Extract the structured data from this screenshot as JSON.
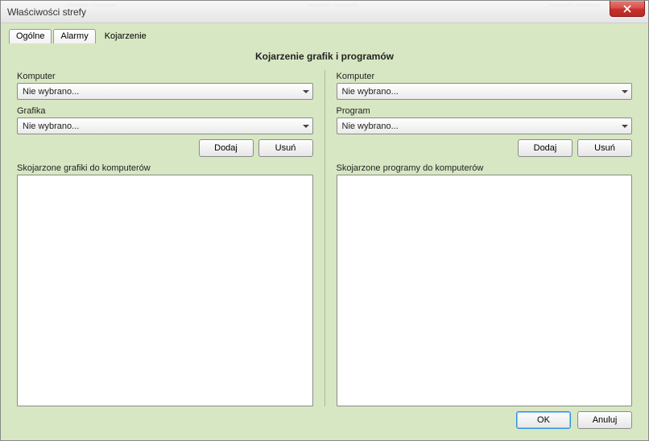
{
  "window": {
    "title": "Właściwości strefy"
  },
  "tabs": [
    {
      "label": "Ogólne"
    },
    {
      "label": "Alarmy"
    },
    {
      "label": "Kojarzenie",
      "active": true
    }
  ],
  "heading": "Kojarzenie grafik i programów",
  "left": {
    "label_computer": "Komputer",
    "dd_computer": "Nie wybrano...",
    "label_graphic": "Grafika",
    "dd_graphic": "Nie wybrano...",
    "btn_add": "Dodaj",
    "btn_remove": "Usuń",
    "label_list": "Skojarzone grafiki do komputerów"
  },
  "right": {
    "label_computer": "Komputer",
    "dd_computer": "Nie wybrano...",
    "label_program": "Program",
    "dd_program": "Nie wybrano...",
    "btn_add": "Dodaj",
    "btn_remove": "Usuń",
    "label_list": "Skojarzone programy do komputerów"
  },
  "footer": {
    "ok": "OK",
    "cancel": "Anuluj"
  }
}
